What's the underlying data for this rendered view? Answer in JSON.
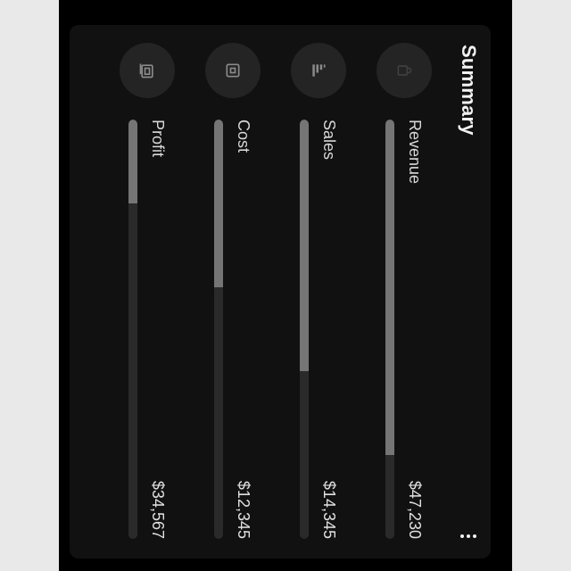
{
  "summary": {
    "title": "Summary",
    "more_icon": "more-vertical-icon",
    "metrics": [
      {
        "label": "Revenue",
        "value": "$47,230",
        "icon": "coffee-cup-icon",
        "progress": 0.8
      },
      {
        "label": "Sales",
        "value": "$14,345",
        "icon": "bar-chart-icon",
        "progress": 0.6
      },
      {
        "label": "Cost",
        "value": "$12,345",
        "icon": "box-icon",
        "progress": 0.4
      },
      {
        "label": "Profit",
        "value": "$34,567",
        "icon": "wallet-icon",
        "progress": 0.2
      }
    ]
  }
}
